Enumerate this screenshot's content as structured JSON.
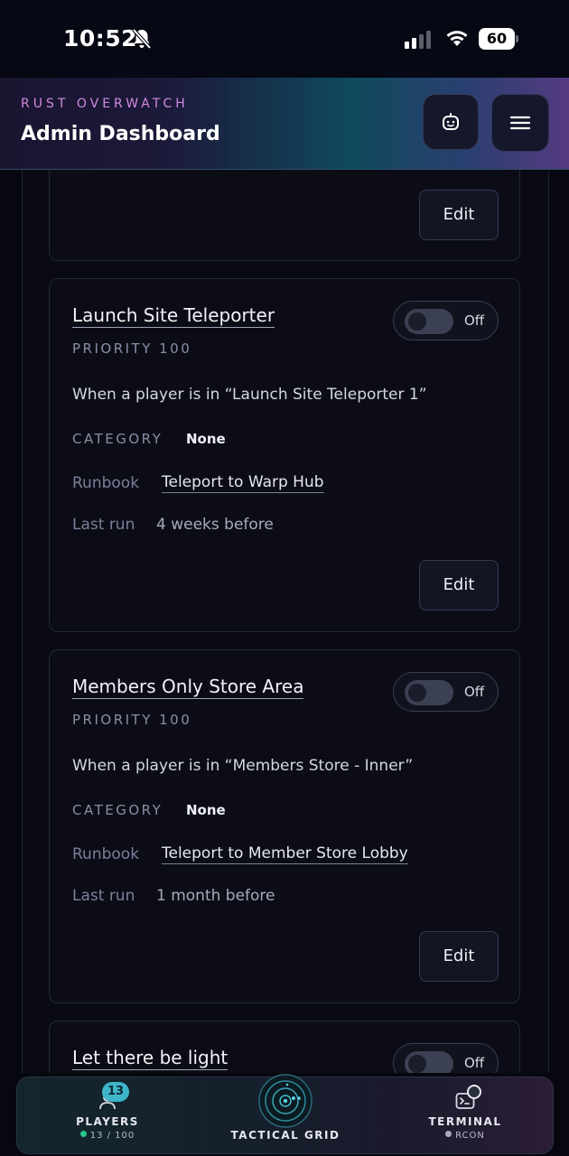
{
  "status_bar": {
    "time": "10:52",
    "battery": "60"
  },
  "header": {
    "brand_sub": "RUST OVERWATCH",
    "title": "Admin Dashboard"
  },
  "cards": [
    {
      "edit_label": "Edit"
    },
    {
      "title": "Launch Site Teleporter",
      "toggle": "Off",
      "priority": "PRIORITY 100",
      "condition": "When a player is in “Launch Site Teleporter 1”",
      "category_label": "CATEGORY",
      "category_value": "None",
      "runbook_label": "Runbook",
      "runbook_value": "Teleport to Warp Hub",
      "last_run_label": "Last run",
      "last_run_value": "4 weeks before",
      "edit_label": "Edit"
    },
    {
      "title": "Members Only Store Area",
      "toggle": "Off",
      "priority": "PRIORITY 100",
      "condition": "When a player is in “Members Store - Inner”",
      "category_label": "CATEGORY",
      "category_value": "None",
      "runbook_label": "Runbook",
      "runbook_value": "Teleport to Member Store Lobby",
      "last_run_label": "Last run",
      "last_run_value": "1 month before",
      "edit_label": "Edit"
    },
    {
      "title": "Let there be light",
      "toggle": "Off"
    }
  ],
  "bottom_nav": {
    "players_label": "PLAYERS",
    "players_count": "13 / 100",
    "players_badge": "13",
    "tactical_label": "TACTICAL GRID",
    "terminal_label": "TERMINAL",
    "terminal_sub": "RCON"
  },
  "colors": {
    "accent_teal": "#3fb5c9",
    "accent_purple": "#d08ae0",
    "online_green": "#28c787"
  }
}
